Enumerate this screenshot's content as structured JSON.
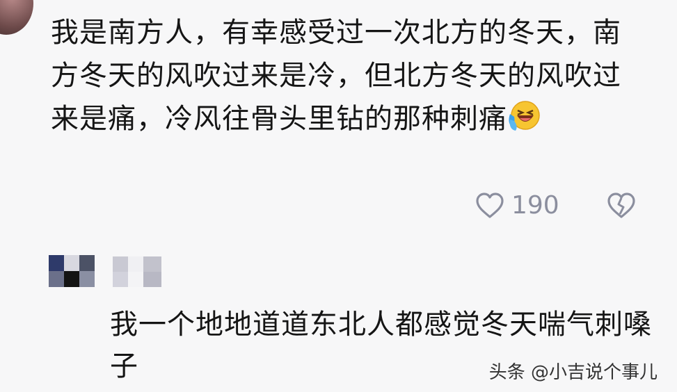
{
  "comment": {
    "text": "我是南方人，有幸感受过一次北方的冬天，南方冬天的风吹过来是冷，但北方冬天的风吹过来是痛，冷风往骨头里钻的那种刺痛",
    "emoji": "crying-laughing-emoji",
    "like_count": "190"
  },
  "reply": {
    "text": "我一个地地道道东北人都感觉冬天喘气刺嗓子"
  },
  "watermark": "头条 @小吉说个事儿",
  "colors": {
    "background": "#f7f7f8",
    "text": "#151515",
    "icon_gray": "#8b8e9e"
  },
  "icons": {
    "like": "heart-outline-icon",
    "dislike": "broken-heart-icon"
  }
}
